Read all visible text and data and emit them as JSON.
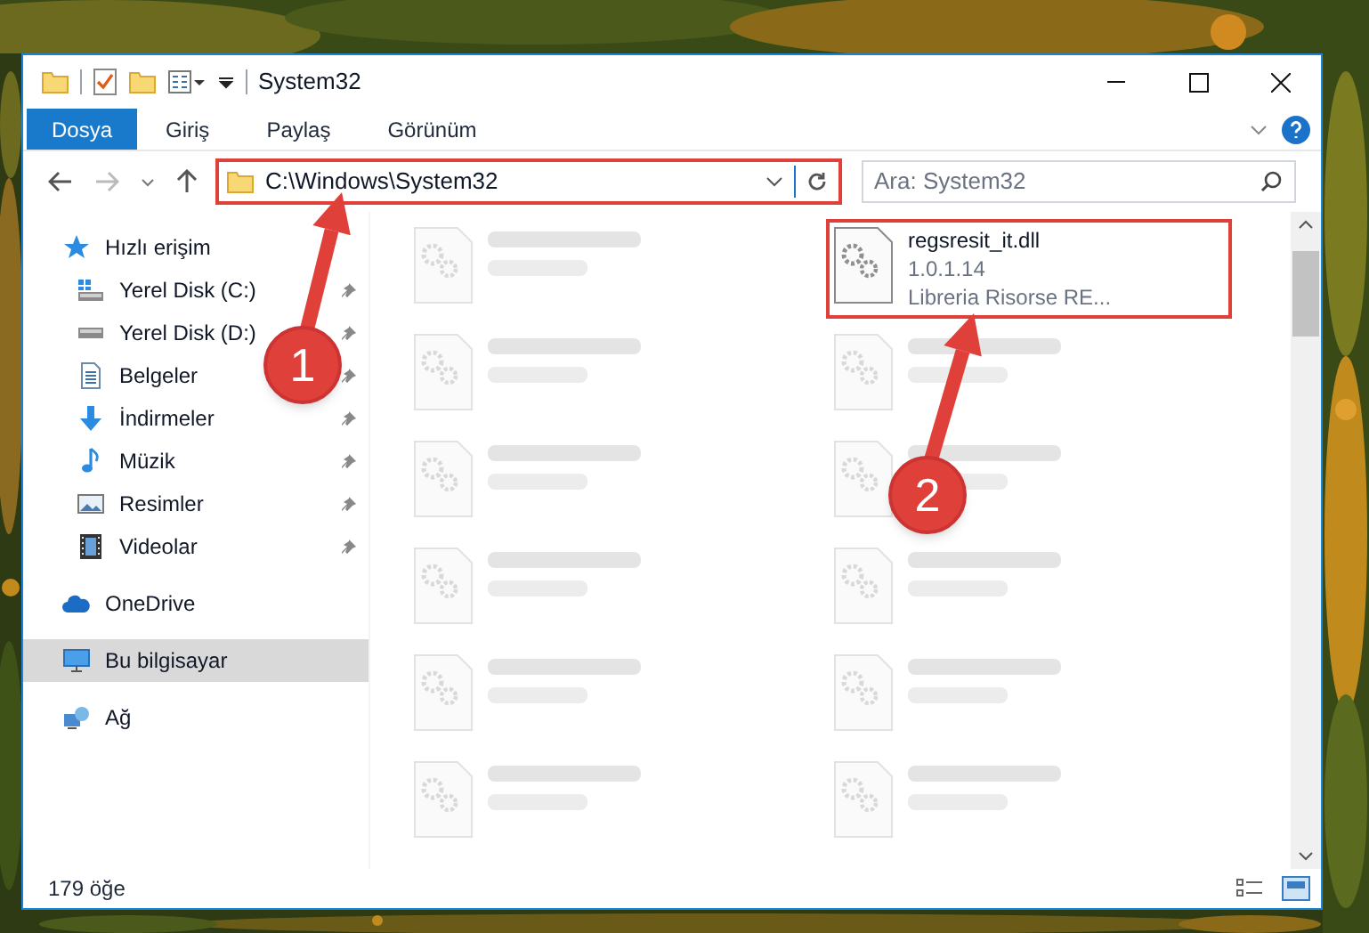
{
  "window": {
    "title": "System32"
  },
  "ribbon_tabs": [
    {
      "label": "Dosya",
      "selected": true
    },
    {
      "label": "Giriş",
      "selected": false
    },
    {
      "label": "Paylaş",
      "selected": false
    },
    {
      "label": "Görünüm",
      "selected": false
    }
  ],
  "address_bar": {
    "path": "C:\\Windows\\System32",
    "highlighted": true
  },
  "search": {
    "placeholder": "Ara: System32"
  },
  "sidebar": {
    "items": [
      {
        "label": "Hızlı erişim",
        "kind": "star",
        "selected": false,
        "children": [
          {
            "label": "Yerel Disk (C:)",
            "kind": "drive-windows",
            "pinned": true,
            "selected": false
          },
          {
            "label": "Yerel Disk (D:)",
            "kind": "drive",
            "pinned": true,
            "selected": false
          },
          {
            "label": "Belgeler",
            "kind": "documents",
            "pinned": true,
            "selected": false
          },
          {
            "label": "İndirmeler",
            "kind": "download",
            "pinned": true,
            "selected": false
          },
          {
            "label": "Müzik",
            "kind": "music",
            "pinned": true,
            "selected": false
          },
          {
            "label": "Resimler",
            "kind": "pictures",
            "pinned": true,
            "selected": false
          },
          {
            "label": "Videolar",
            "kind": "videos",
            "pinned": true,
            "selected": false
          }
        ]
      },
      {
        "label": "OneDrive",
        "kind": "cloud",
        "selected": false
      },
      {
        "label": "Bu bilgisayar",
        "kind": "computer",
        "selected": true
      },
      {
        "label": "Ağ",
        "kind": "network",
        "selected": false
      }
    ]
  },
  "files": [
    {
      "blurred": true,
      "highlighted": false
    },
    {
      "name": "regsresit_it.dll",
      "details": [
        "1.0.1.14",
        "Libreria Risorse RE..."
      ],
      "blurred": false,
      "highlighted": true
    },
    {
      "blurred": true,
      "highlighted": false
    },
    {
      "blurred": true,
      "highlighted": false
    },
    {
      "blurred": true,
      "highlighted": false
    },
    {
      "blurred": true,
      "highlighted": false
    },
    {
      "blurred": true,
      "highlighted": false
    },
    {
      "blurred": true,
      "highlighted": false
    },
    {
      "blurred": true,
      "highlighted": false
    },
    {
      "blurred": true,
      "highlighted": false
    },
    {
      "blurred": true,
      "highlighted": false
    },
    {
      "blurred": true,
      "highlighted": false
    }
  ],
  "status_bar": {
    "item_count": "179 öğe"
  },
  "annotations": [
    {
      "number": "1"
    },
    {
      "number": "2"
    }
  ]
}
